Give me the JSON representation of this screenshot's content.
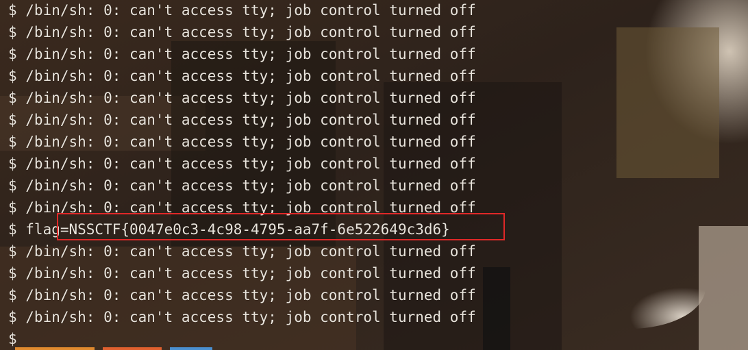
{
  "terminal": {
    "lines_before": [
      "$ /bin/sh: 0: can't access tty; job control turned off",
      "$ /bin/sh: 0: can't access tty; job control turned off",
      "$ /bin/sh: 0: can't access tty; job control turned off",
      "$ /bin/sh: 0: can't access tty; job control turned off",
      "$ /bin/sh: 0: can't access tty; job control turned off",
      "$ /bin/sh: 0: can't access tty; job control turned off",
      "$ /bin/sh: 0: can't access tty; job control turned off",
      "$ /bin/sh: 0: can't access tty; job control turned off",
      "$ /bin/sh: 0: can't access tty; job control turned off",
      "$ /bin/sh: 0: can't access tty; job control turned off"
    ],
    "flag_line": "$ flag=NSSCTF{0047e0c3-4c98-4795-aa7f-6e522649c3d6}",
    "lines_after": [
      "$ /bin/sh: 0: can't access tty; job control turned off",
      "$ /bin/sh: 0: can't access tty; job control turned off",
      "$ /bin/sh: 0: can't access tty; job control turned off",
      "$ /bin/sh: 0: can't access tty; job control turned off"
    ],
    "prompt": "$"
  },
  "colors": {
    "text": "#e9e4dc",
    "highlight_border": "#e02828"
  }
}
